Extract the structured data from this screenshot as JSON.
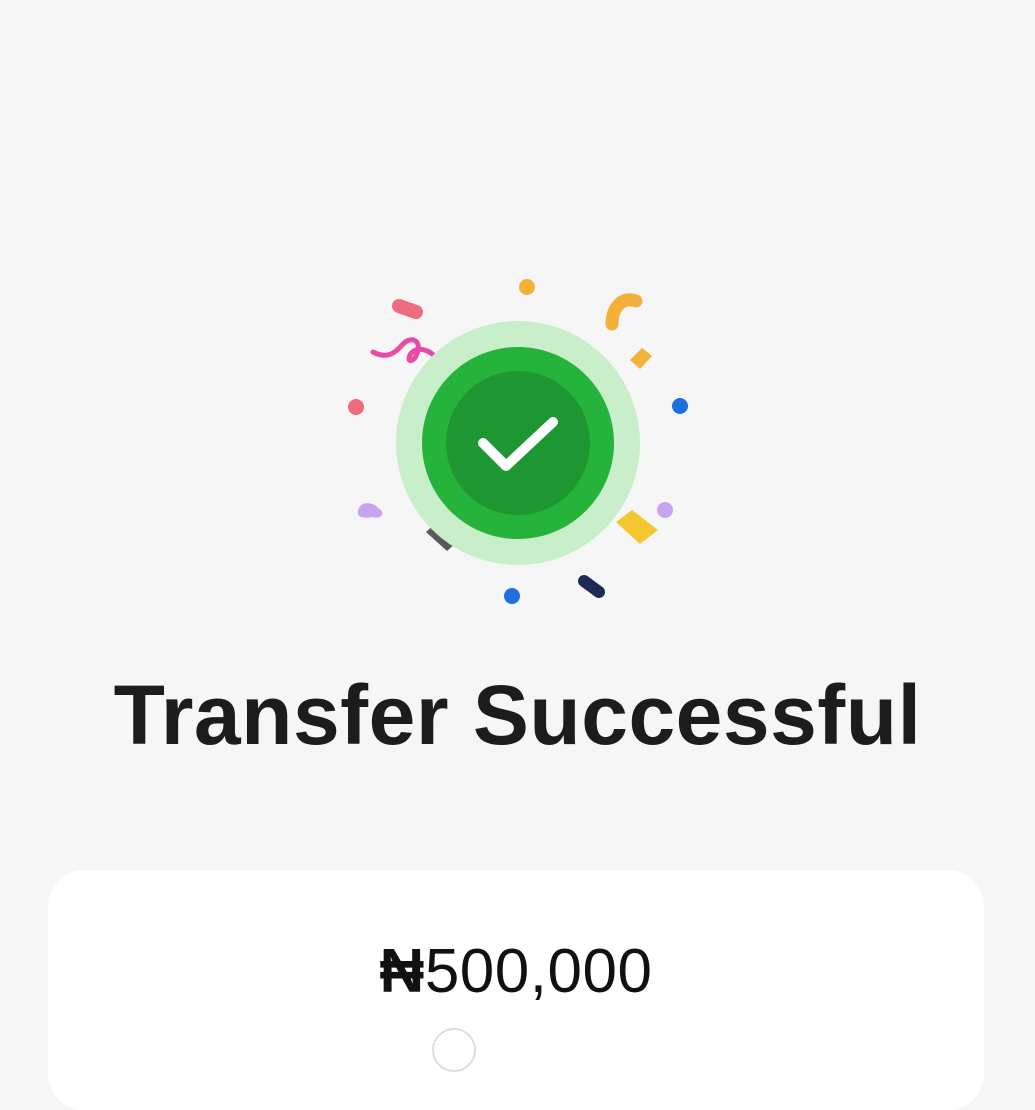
{
  "status": {
    "title": "Transfer Successful",
    "icon": "check-circle-icon",
    "colors": {
      "halo": "#c8efc9",
      "ring": "#25b33b",
      "inner": "#1e9631",
      "check": "#ffffff"
    }
  },
  "confetti_icon": "confetti-icon",
  "transfer": {
    "currency_symbol": "₦",
    "amount": "500,000"
  }
}
